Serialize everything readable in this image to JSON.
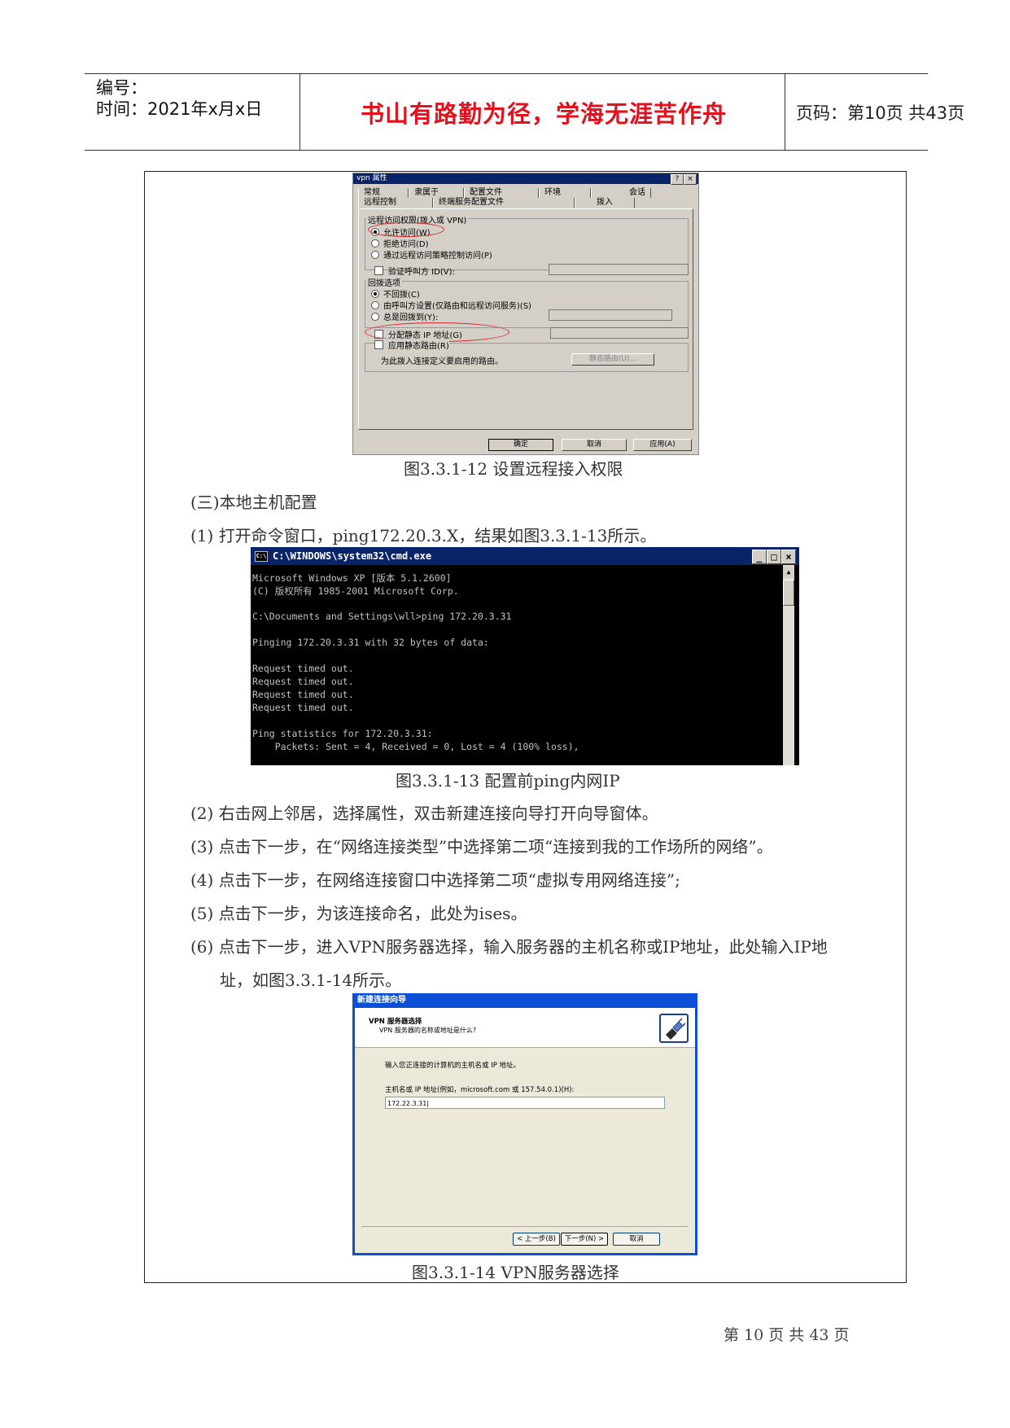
{
  "header": {
    "number_label": "编号：",
    "time_label": "时间：2021年x月x日",
    "motto": "书山有路勤为径，学海无涯苦作舟",
    "page_label": "页码：第10页 共43页"
  },
  "figure1": {
    "title": "vpn 属性",
    "help_btn": "?",
    "close_btn": "×",
    "tabs_row1": [
      "常规",
      "隶属于",
      "配置文件",
      "环境",
      "会话"
    ],
    "tabs_row2": [
      "远程控制",
      "终端服务配置文件",
      "拨入"
    ],
    "group1_label": "远程访问权限(拨入或 VPN)",
    "radio_allow": "允许访问(W)",
    "radio_deny": "拒绝访问(D)",
    "radio_policy": "通过远程访问策略控制访问(P)",
    "check_callerid": "验证呼叫方 ID(V):",
    "group2_label": "回拨选项",
    "radio_nocallback": "不回拨(C)",
    "radio_callerset": "由呼叫方设置(仅路由和远程访问服务)(S)",
    "radio_always": "总是回拨到(Y):",
    "check_static_ip": "分配静态 IP 地址(G)",
    "check_static_route": "应用静态路由(R)",
    "route_desc": "为此拨入连接定义要启用的路由。",
    "route_btn": "静态路由(U)...",
    "ok": "确定",
    "cancel": "取消",
    "apply": "应用(A)",
    "caption": "图3.3.1-12 设置远程接入权限"
  },
  "section_title": "(三)本地主机配置",
  "step1": "(1) 打开命令窗口，ping172.20.3.X，结果如图3.3.1-13所示。",
  "figure2": {
    "icon_text": "C:\\",
    "title": "C:\\WINDOWS\\system32\\cmd.exe",
    "min_btn": "_",
    "max_btn": "□",
    "close_btn": "×",
    "scroll_up": "▲",
    "lines": [
      "Microsoft Windows XP [版本 5.1.2600]",
      "(C) 版权所有 1985-2001 Microsoft Corp.",
      "",
      "C:\\Documents and Settings\\wll>ping 172.20.3.31",
      "",
      "Pinging 172.20.3.31 with 32 bytes of data:",
      "",
      "Request timed out.",
      "Request timed out.",
      "Request timed out.",
      "Request timed out.",
      "",
      "Ping statistics for 172.20.3.31:",
      "    Packets: Sent = 4, Received = 0, Lost = 4 (100% loss),"
    ],
    "caption": "图3.3.1-13 配置前ping内网IP"
  },
  "step2": "(2) 右击网上邻居，选择属性，双击新建连接向导打开向导窗体。",
  "step3": "(3) 点击下一步，在“网络连接类型”中选择第二项“连接到我的工作场所的网络”。",
  "step4": "(4) 点击下一步，在网络连接窗口中选择第二项“虚拟专用网络连接”;",
  "step5": "(5) 点击下一步，为该连接命名，此处为ises。",
  "step6_line1": "(6) 点击下一步，进入VPN服务器选择，输入服务器的主机名称或IP地址，此处输入IP地",
  "step6_line2": "址，如图3.3.1-14所示。",
  "figure3": {
    "title": "新建连接向导",
    "heading": "VPN 服务器选择",
    "subheading": "VPN 服务器的名称或地址是什么?",
    "prompt": "输入您正连接的计算机的主机名或 IP 地址。",
    "field_label": "主机名或 IP 地址(例如，microsoft.com 或 157.54.0.1)(H):",
    "field_value": "172.22.3.31|",
    "back": "< 上一步(B)",
    "next": "下一步(N) >",
    "cancel": "取消",
    "caption": "图3.3.1-14 VPN服务器选择"
  },
  "footer": "第 10 页 共 43 页"
}
